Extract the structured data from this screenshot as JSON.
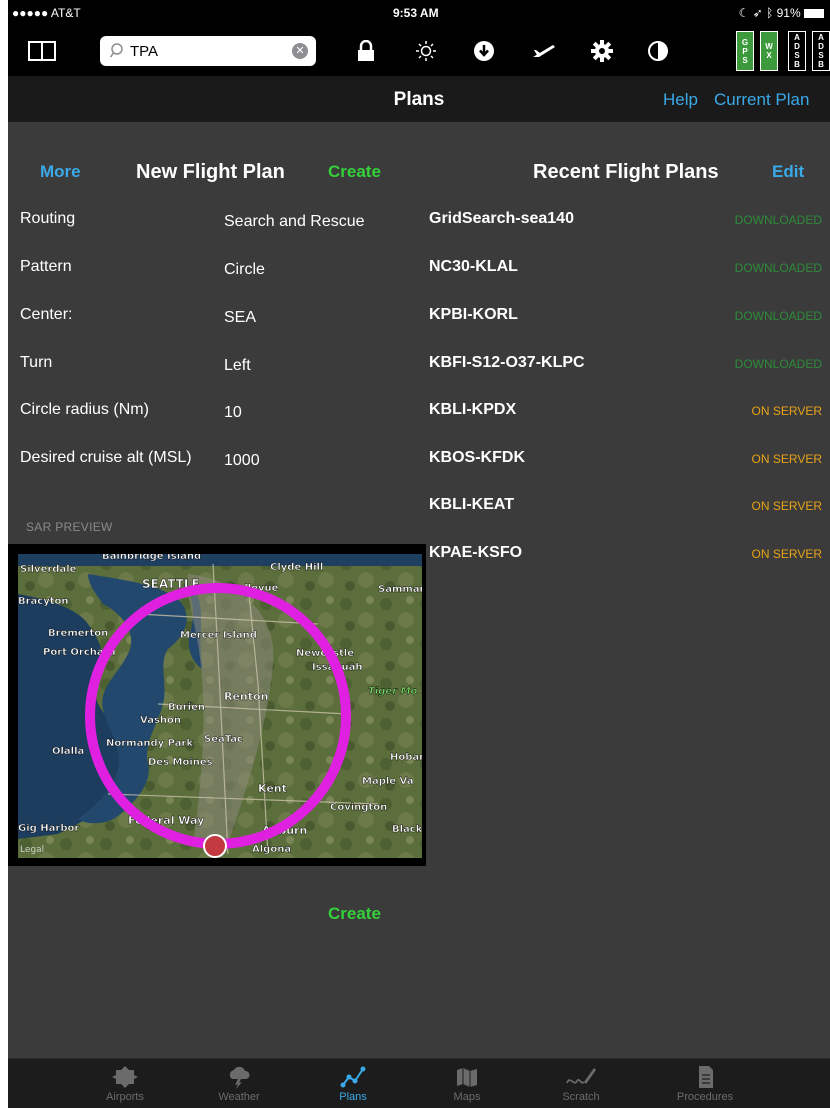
{
  "status_bar": {
    "carrier": "●●●●● AT&T",
    "time": "9:53 AM",
    "battery": "91%"
  },
  "toolbar": {
    "search_value": "TPA",
    "badges": [
      {
        "letters": [
          "G",
          "P",
          "S"
        ],
        "style": "green"
      },
      {
        "letters": [
          "W",
          "X"
        ],
        "style": "green"
      },
      {
        "letters": [
          "A",
          "D",
          "S",
          "B"
        ],
        "style": "black"
      },
      {
        "letters": [
          "A",
          "D",
          "S",
          "B"
        ],
        "style": "black"
      }
    ],
    "icons": [
      "sidebar-icon",
      "lock-icon",
      "brightness-icon",
      "download-icon",
      "airplane-icon",
      "gear-icon",
      "contrast-icon"
    ]
  },
  "nav": {
    "title": "Plans",
    "help": "Help",
    "current_plan": "Current Plan"
  },
  "new_plan": {
    "more": "More",
    "title": "New Flight Plan",
    "create": "Create",
    "fields": [
      {
        "label": "Routing",
        "value": "Search and Rescue"
      },
      {
        "label": "Pattern",
        "value": "Circle"
      },
      {
        "label": "Center:",
        "value": "SEA"
      },
      {
        "label": "Turn",
        "value": "Left"
      },
      {
        "label": "Circle radius (Nm)",
        "value": "10"
      },
      {
        "label": "Desired cruise alt (MSL)",
        "value": "1000"
      }
    ],
    "preview_label": "SAR PREVIEW",
    "map_labels": [
      "Bainbridge Island",
      "Silverdale",
      "SEATTLE",
      "Bellevue",
      "Clyde Hill",
      "Sammam",
      "Bracyton",
      "Bremerton",
      "Mercer Island",
      "Port Orchard",
      "Newcastle",
      "Issaquah",
      "Renton",
      "Tiger Mo State Fo",
      "Burien",
      "Vashon",
      "Normandy Park",
      "SeaTac",
      "Olalla",
      "Des Moines",
      "Hobar",
      "Kent",
      "Maple Va",
      "Covington",
      "Federal Way",
      "Auburn",
      "Gig Harbor",
      "Black",
      "Algona",
      "Legal"
    ],
    "create_bottom": "Create"
  },
  "recent": {
    "title": "Recent Flight Plans",
    "edit": "Edit",
    "plans": [
      {
        "name": "GridSearch-sea140",
        "status": "DOWNLOADED",
        "kind": "down"
      },
      {
        "name": "NC30-KLAL",
        "status": "DOWNLOADED",
        "kind": "down"
      },
      {
        "name": "KPBI-KORL",
        "status": "DOWNLOADED",
        "kind": "down"
      },
      {
        "name": "KBFI-S12-O37-KLPC",
        "status": "DOWNLOADED",
        "kind": "down"
      },
      {
        "name": "KBLI-KPDX",
        "status": "ON SERVER",
        "kind": "server"
      },
      {
        "name": "KBOS-KFDK",
        "status": "ON SERVER",
        "kind": "server"
      },
      {
        "name": "KBLI-KEAT",
        "status": "ON SERVER",
        "kind": "server"
      },
      {
        "name": "KPAE-KSFO",
        "status": "ON SERVER",
        "kind": "server"
      }
    ]
  },
  "tabs": [
    {
      "label": "Airports",
      "icon": "airport-icon",
      "active": false
    },
    {
      "label": "Weather",
      "icon": "weather-icon",
      "active": false
    },
    {
      "label": "Plans",
      "icon": "plans-icon",
      "active": true
    },
    {
      "label": "Maps",
      "icon": "maps-icon",
      "active": false
    },
    {
      "label": "Scratch",
      "icon": "scratch-icon",
      "active": false
    },
    {
      "label": "Procedures",
      "icon": "procedures-icon",
      "active": false
    }
  ],
  "colors": {
    "accent_blue": "#3aa9e8",
    "create_green": "#34d13a",
    "downloaded": "#2e8b3a",
    "on_server": "#e8a317",
    "sar_circle": "#e020e0"
  }
}
